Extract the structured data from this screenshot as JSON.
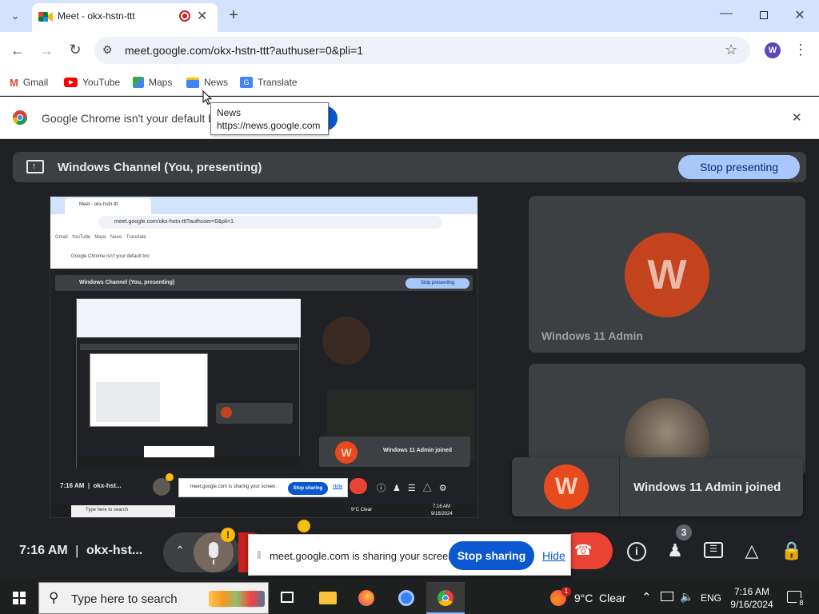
{
  "browser": {
    "tab_title": "Meet - okx-hstn-ttt",
    "url": "meet.google.com/okx-hstn-ttt?authuser=0&pli=1",
    "profile_initial": "W",
    "bookmarks": [
      "Gmail",
      "YouTube",
      "Maps",
      "News",
      "Translate"
    ],
    "infobar_text": "Google Chrome isn't your default bro",
    "tooltip": {
      "title": "News",
      "url": "https://news.google.com"
    }
  },
  "meet": {
    "presenting_label": "Windows Channel (You, presenting)",
    "stop_presenting": "Stop presenting",
    "participant_name": "Windows 11 Admin",
    "avatar_initial": "W",
    "join_toast": "Windows 11 Admin joined",
    "time": "7:16 AM",
    "meeting_code": "okx-hst...",
    "people_count": "3",
    "warning_badge": "!",
    "share_banner": {
      "text": "meet.google.com is sharing your screen.",
      "stop": "Stop sharing",
      "hide": "Hide"
    },
    "inner": {
      "time": "7:16 AM",
      "code": "okx-hst...",
      "mini_share_text": "meet.google.com is sharing your screen.",
      "mini_stop": "Stop sharing",
      "mini_hide": "Hide",
      "mini_join": "Windows 11 Admin joined",
      "mini_url": "meet.google.com/okx-hstn-ttt?authuser=0&pli=1",
      "mini_tab": "Meet - okx-hstn-ttt",
      "mini_infobar": "Google Chrome isn't your default bro",
      "mini_taskbar_search": "Type here to search",
      "mini_weather": "9°C Clear",
      "mini_clock_time": "7:16 AM",
      "mini_clock_date": "9/16/2024"
    }
  },
  "taskbar": {
    "search_placeholder": "Type here to search",
    "weather_temp": "9°C",
    "weather_desc": "Clear",
    "language": "ENG",
    "clock_time": "7:16 AM",
    "clock_date": "9/16/2024",
    "notification_count": "8",
    "weather_badge": "1"
  },
  "colors": {
    "tab_strip": "#d3e3fd",
    "accent": "#0b57d0",
    "end_call": "#ea4335",
    "avatar": "#c2431e",
    "meet_bg": "#202124"
  }
}
